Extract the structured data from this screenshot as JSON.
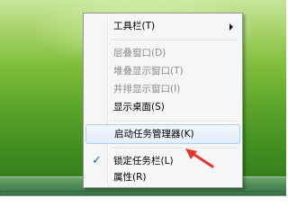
{
  "context_menu": {
    "items": [
      {
        "label": "工具栏(T)",
        "enabled": true,
        "submenu": true
      },
      {
        "label": "层叠窗口(D)",
        "enabled": false
      },
      {
        "label": "堆叠显示窗口(T)",
        "enabled": false
      },
      {
        "label": "并排显示窗口(I)",
        "enabled": false
      },
      {
        "label": "显示桌面(S)",
        "enabled": true
      },
      {
        "label": "启动任务管理器(K)",
        "enabled": true,
        "highlighted": true
      },
      {
        "label": "锁定任务栏(L)",
        "enabled": true,
        "checked": true
      },
      {
        "label": "属性(R)",
        "enabled": true
      }
    ]
  },
  "annotation": {
    "color": "#e8342a",
    "icon": "red-arrow-icon"
  },
  "colors": {
    "highlight_border": "#aecff7",
    "menu_bg": "#f5f6f7"
  }
}
